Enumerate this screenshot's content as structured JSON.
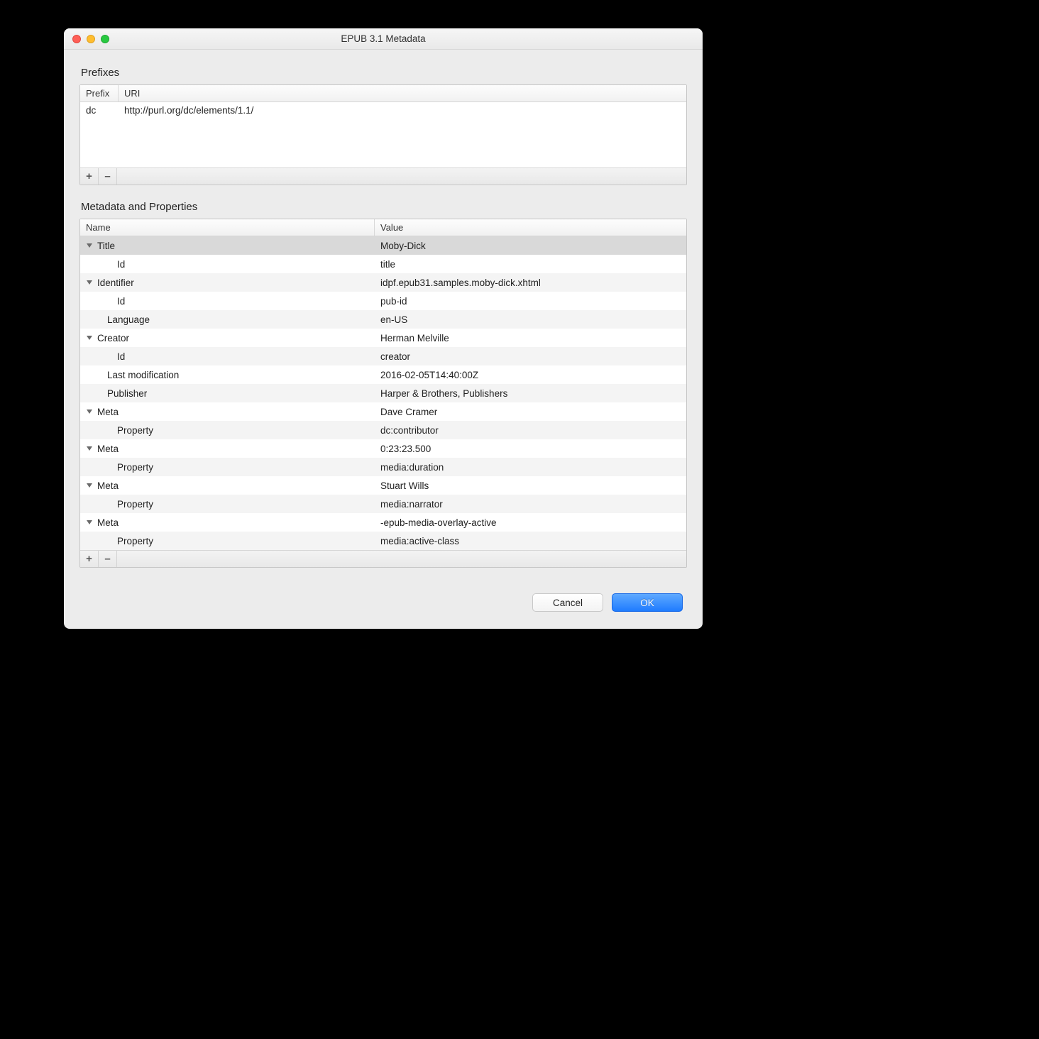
{
  "window": {
    "title": "EPUB 3.1 Metadata"
  },
  "sections": {
    "prefixes_label": "Prefixes",
    "metadata_label": "Metadata and Properties"
  },
  "prefix_table": {
    "headers": {
      "prefix": "Prefix",
      "uri": "URI"
    },
    "rows": [
      {
        "prefix": "dc",
        "uri": "http://purl.org/dc/elements/1.1/"
      }
    ]
  },
  "metadata_table": {
    "headers": {
      "name": "Name",
      "value": "Value"
    },
    "rows": [
      {
        "indent": 0,
        "arrow": true,
        "selected": true,
        "name": "Title",
        "value": "Moby-Dick"
      },
      {
        "indent": 2,
        "arrow": false,
        "selected": false,
        "name": "Id",
        "value": "title"
      },
      {
        "indent": 0,
        "arrow": true,
        "selected": false,
        "name": "Identifier",
        "value": "idpf.epub31.samples.moby-dick.xhtml"
      },
      {
        "indent": 2,
        "arrow": false,
        "selected": false,
        "name": "Id",
        "value": "pub-id"
      },
      {
        "indent": 1,
        "arrow": false,
        "selected": false,
        "name": "Language",
        "value": "en-US"
      },
      {
        "indent": 0,
        "arrow": true,
        "selected": false,
        "name": "Creator",
        "value": "Herman Melville"
      },
      {
        "indent": 2,
        "arrow": false,
        "selected": false,
        "name": "Id",
        "value": "creator"
      },
      {
        "indent": 1,
        "arrow": false,
        "selected": false,
        "name": "Last modification",
        "value": "2016-02-05T14:40:00Z"
      },
      {
        "indent": 1,
        "arrow": false,
        "selected": false,
        "name": "Publisher",
        "value": "Harper & Brothers, Publishers"
      },
      {
        "indent": 0,
        "arrow": true,
        "selected": false,
        "name": "Meta",
        "value": "Dave Cramer"
      },
      {
        "indent": 2,
        "arrow": false,
        "selected": false,
        "name": "Property",
        "value": "dc:contributor"
      },
      {
        "indent": 0,
        "arrow": true,
        "selected": false,
        "name": "Meta",
        "value": "0:23:23.500"
      },
      {
        "indent": 2,
        "arrow": false,
        "selected": false,
        "name": "Property",
        "value": "media:duration"
      },
      {
        "indent": 0,
        "arrow": true,
        "selected": false,
        "name": "Meta",
        "value": "Stuart Wills"
      },
      {
        "indent": 2,
        "arrow": false,
        "selected": false,
        "name": "Property",
        "value": "media:narrator"
      },
      {
        "indent": 0,
        "arrow": true,
        "selected": false,
        "name": "Meta",
        "value": "-epub-media-overlay-active"
      },
      {
        "indent": 2,
        "arrow": false,
        "selected": false,
        "name": "Property",
        "value": "media:active-class"
      }
    ]
  },
  "buttons": {
    "cancel": "Cancel",
    "ok": "OK"
  },
  "toolbar": {
    "plus": "+",
    "minus": "–"
  }
}
